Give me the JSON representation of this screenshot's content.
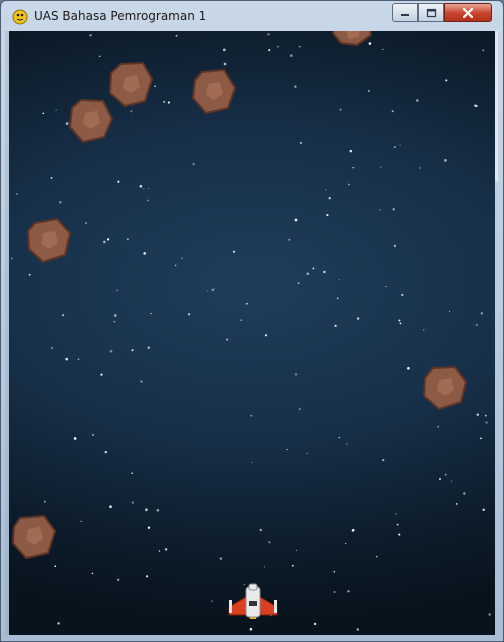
{
  "window": {
    "title": "UAS Bahasa Pemrograman 1",
    "app_icon": "pygame-snake-icon",
    "controls": {
      "minimize_icon": "minimize-icon",
      "maximize_icon": "maximize-icon",
      "close_icon": "close-icon"
    }
  },
  "game": {
    "background": "starfield",
    "colors": {
      "space_center": "#1f3d5a",
      "space_edge": "#08131d",
      "asteroid": "#8d5a45",
      "asteroid_outline": "#5c3527",
      "ship_body": "#e9e9ec",
      "ship_wing": "#d8401f",
      "ship_flame": "#f3b21f"
    },
    "asteroid_count": 7,
    "player": "spaceship"
  }
}
